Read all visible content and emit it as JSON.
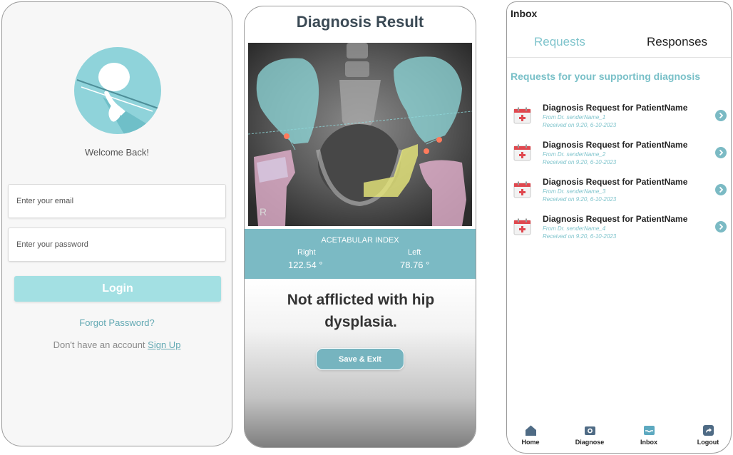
{
  "login": {
    "welcome": "Welcome Back!",
    "email_placeholder": "Enter your email",
    "password_placeholder": "Enter your password",
    "login_label": "Login",
    "forgot_label": "Forgot Password?",
    "no_account_text": "Don't have an account",
    "signup_label": "Sign Up"
  },
  "result": {
    "title": "Diagnosis Result",
    "xray_marker": "R",
    "acetabular": {
      "title": "ACETABULAR INDEX",
      "right_label": "Right",
      "left_label": "Left",
      "right_value": "122.54 °",
      "left_value": "78.76 °"
    },
    "verdict": "Not afflicted with hip dysplasia.",
    "save_label": "Save & Exit"
  },
  "inbox": {
    "heading": "Inbox",
    "tabs": [
      "Requests",
      "Responses"
    ],
    "active_tab": "Requests",
    "section_title": "Requests for your supporting diagnosis",
    "requests": [
      {
        "title": "Diagnosis Request for PatientName",
        "from": "From Dr. senderName_1",
        "received": "Received on 9:20, 6-10-2023"
      },
      {
        "title": "Diagnosis Request for PatientName",
        "from": "From Dr. senderName_2",
        "received": "Received on 9:20, 6-10-2023"
      },
      {
        "title": "Diagnosis Request for PatientName",
        "from": "From Dr. senderName_3",
        "received": "Received on 9:20, 6-10-2023"
      },
      {
        "title": "Diagnosis Request for PatientName",
        "from": "From Dr. senderName_4",
        "received": "Received on 9:20, 6-10-2023"
      }
    ],
    "nav": [
      {
        "label": "Home",
        "icon": "home-icon"
      },
      {
        "label": "Diagnose",
        "icon": "camera-icon"
      },
      {
        "label": "Inbox",
        "icon": "inbox-icon"
      },
      {
        "label": "Logout",
        "icon": "logout-icon"
      }
    ]
  },
  "colors": {
    "accent": "#7bbac4",
    "accent_light": "#a3e0e3",
    "link": "#63a9b3",
    "calendar_red": "#e0484f",
    "icon_dark": "#4f6b85"
  }
}
